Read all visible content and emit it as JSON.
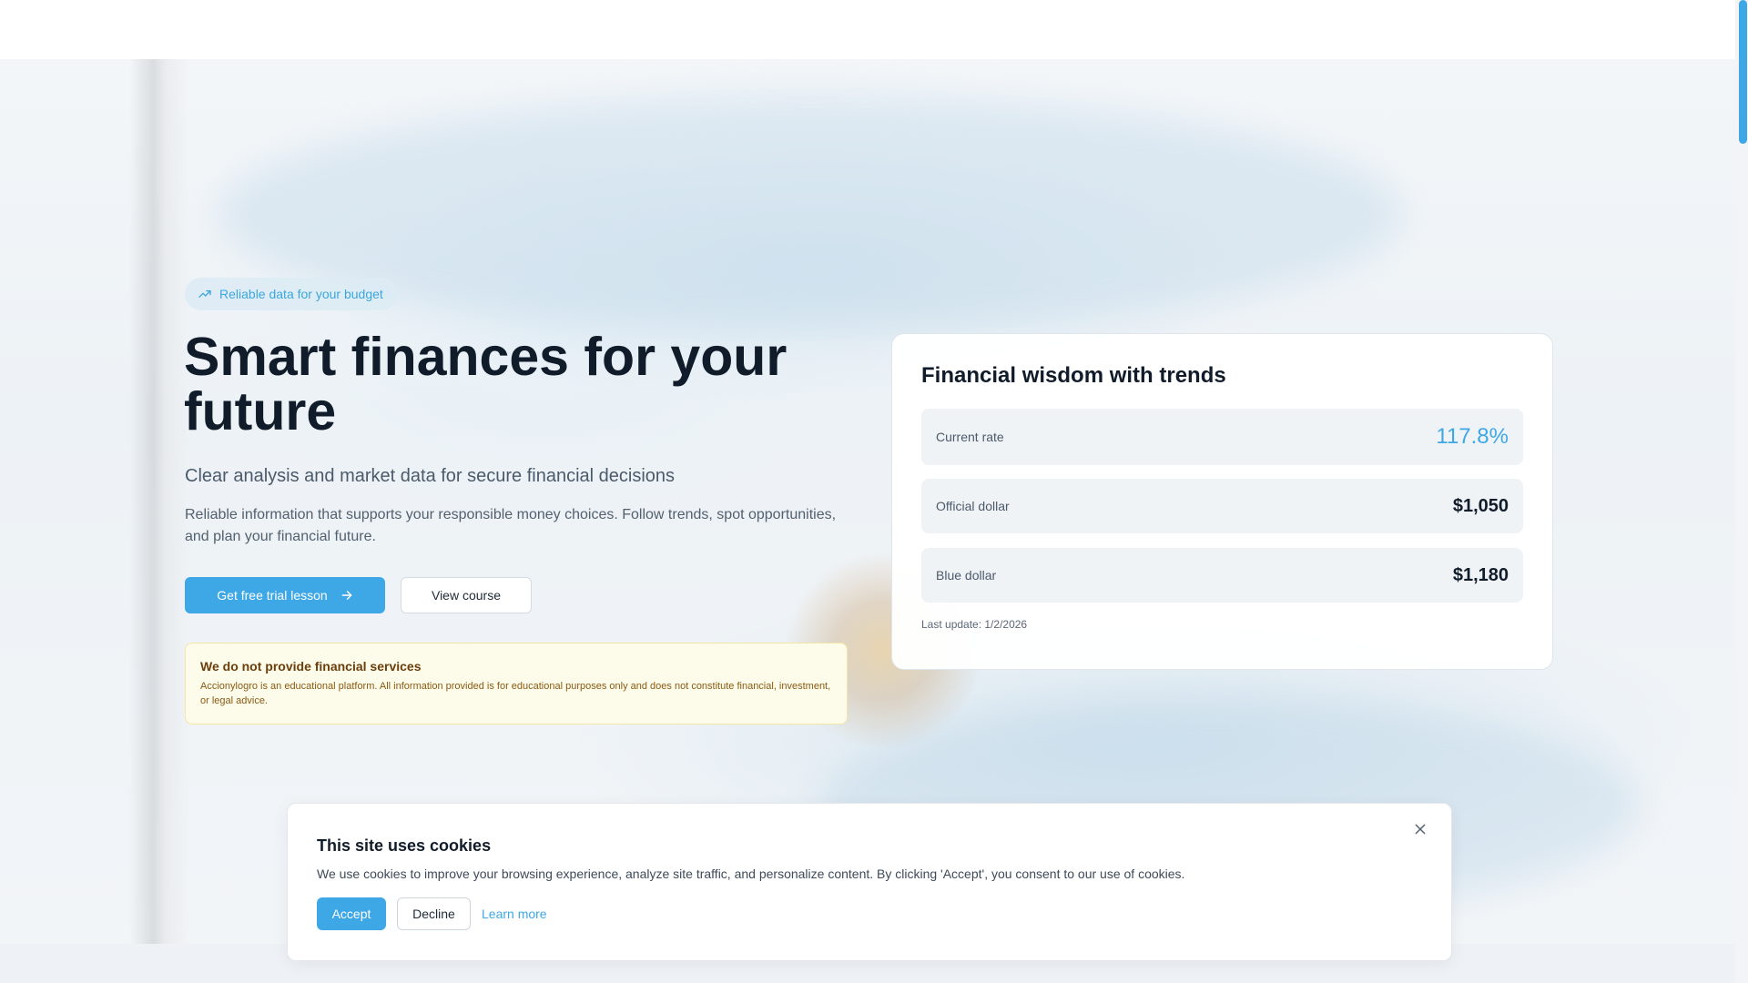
{
  "hero": {
    "badge": {
      "icon": "trending-up-icon",
      "label": "Reliable data for your budget"
    },
    "headline": "Smart finances for your future",
    "subheadline": "Clear analysis and market data for secure financial decisions",
    "description": "Reliable information that supports your responsible money choices. Follow trends, spot opportunities, and plan your financial future.",
    "primary_button": {
      "label": "Get free trial lesson",
      "icon": "arrow-right-icon"
    },
    "secondary_button": {
      "label": "View course"
    }
  },
  "notice": {
    "title": "We do not provide financial services",
    "text": "Accionylogro is an educational platform. All information provided is for educational purposes only and does not constitute financial, investment, or legal advice."
  },
  "rates_card": {
    "title": "Financial wisdom with trends",
    "rows": [
      {
        "label": "Current rate",
        "value": "117.8%"
      },
      {
        "label": "Official dollar",
        "value": "$1,050"
      },
      {
        "label": "Blue dollar",
        "value": "$1,180"
      }
    ],
    "last_update": "Last update: 1/2/2026"
  },
  "cookie_banner": {
    "title": "This site uses cookies",
    "text": "We use cookies to improve your browsing experience, analyze site traffic, and personalize content. By clicking 'Accept', you consent to our use of cookies.",
    "accept_label": "Accept",
    "decline_label": "Decline",
    "learn_more_label": "Learn more",
    "close_icon": "close-icon"
  },
  "colors": {
    "accent": "#3ea8e6",
    "headline": "#111c2b",
    "notice_bg": "#fdfbe9",
    "notice_text": "#8a5a12"
  }
}
